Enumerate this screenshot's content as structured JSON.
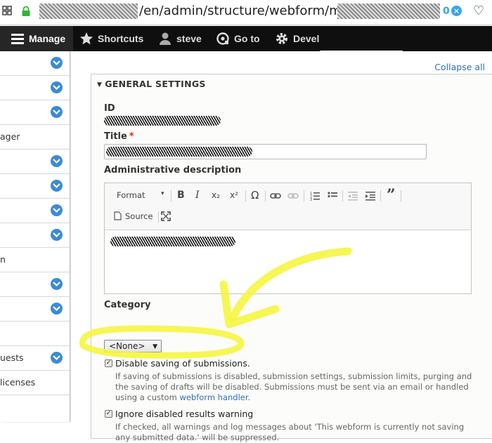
{
  "browser": {
    "url_path": "/en/admin/structure/webform/manage/",
    "badge_count": "0",
    "badge_x": "×"
  },
  "toolbar": {
    "items": [
      {
        "label": "Manage"
      },
      {
        "label": "Shortcuts"
      },
      {
        "label": "steve"
      },
      {
        "label": "Go to"
      },
      {
        "label": "Devel"
      }
    ]
  },
  "sidebar": {
    "labels": [
      "",
      "",
      "",
      "ager",
      "",
      "",
      "",
      "",
      "n",
      "",
      "",
      "",
      "uests",
      " licenses"
    ]
  },
  "main": {
    "collapse_all": "Collapse all",
    "section_title": "GENERAL SETTINGS",
    "section_toggle": "▼",
    "id_label": "ID",
    "title_label": "Title",
    "required_mark": "*",
    "admin_desc_label": "Administrative description",
    "editor": {
      "format_label": "Format",
      "bold": "B",
      "italic": "I",
      "subscript": "x₂",
      "superscript": "x²",
      "omega": "Ω",
      "source_label": "Source"
    },
    "category_label": "Category",
    "category_value": "<None>",
    "disable_saving": {
      "label": "Disable saving of submissions.",
      "description": "If saving of submissions is disabled, submission settings, submission limits, purging and the saving of drafts will be disabled. Submissions must be sent via an email or handled using a custom",
      "link": "webform handler",
      "period": "."
    },
    "ignore_warning": {
      "label": "Ignore disabled results warning",
      "description": "If checked, all warnings and log messages about 'This webform is currently not saving any submitted data.' will be suppressed."
    }
  },
  "colors": {
    "toolbar_bg": "#0f0f0f",
    "link": "#2d73b9",
    "chevron": "#3b8bd4",
    "required": "#e62600",
    "annotation": "#f5f542"
  }
}
